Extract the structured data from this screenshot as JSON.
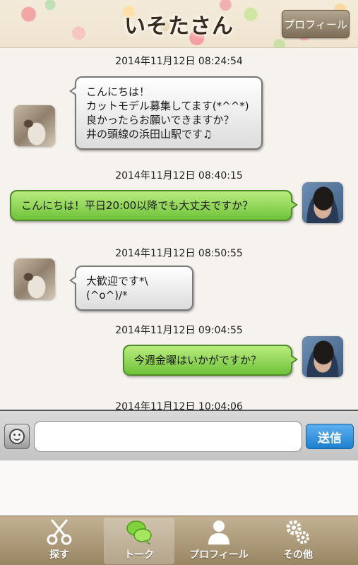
{
  "header": {
    "title": "いそたさん",
    "profile_button": "プロフィール"
  },
  "messages": [
    {
      "timestamp": "2014年11月12日 08:24:54",
      "side": "left",
      "text": "こんにちは！\nカットモデル募集してます(*^^*)\n良かったらお願いできますか？\n井の頭線の浜田山駅です♫"
    },
    {
      "timestamp": "2014年11月12日 08:40:15",
      "side": "right",
      "text": "こんにちは！平日20:00以降でも大丈夫ですか？"
    },
    {
      "timestamp": "2014年11月12日 08:50:55",
      "side": "left",
      "text": "大歓迎です*\\(^o^)/*"
    },
    {
      "timestamp": "2014年11月12日 09:04:55",
      "side": "right",
      "text": "今週金曜はいかがですか？"
    },
    {
      "timestamp": "2014年11月12日 10:04:06",
      "side": "left",
      "text": ""
    }
  ],
  "input": {
    "value": "",
    "placeholder": "",
    "send_label": "送信"
  },
  "tabs": [
    {
      "label": "探す",
      "icon": "scissors-icon",
      "active": false
    },
    {
      "label": "トーク",
      "icon": "chat-bubbles-icon",
      "active": true
    },
    {
      "label": "プロフィール",
      "icon": "person-icon",
      "active": false
    },
    {
      "label": "その他",
      "icon": "gears-icon",
      "active": false
    }
  ],
  "colors": {
    "outgoing_bubble": "#8fd458",
    "incoming_bubble": "#eeeeee",
    "send_button": "#2b8fe0",
    "tabbar": "#ad9a78"
  }
}
